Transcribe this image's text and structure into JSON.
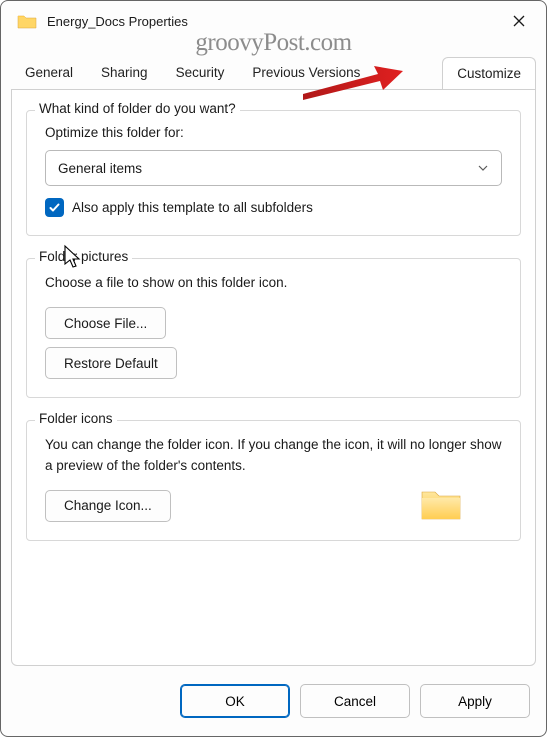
{
  "window": {
    "title": "Energy_Docs Properties"
  },
  "watermark": "groovyPost.com",
  "tabs": [
    {
      "label": "General",
      "active": false
    },
    {
      "label": "Sharing",
      "active": false
    },
    {
      "label": "Security",
      "active": false
    },
    {
      "label": "Previous Versions",
      "active": false
    },
    {
      "label": "Customize",
      "active": true
    }
  ],
  "section_kind": {
    "legend": "What kind of folder do you want?",
    "optimize_label": "Optimize this folder for:",
    "select_value": "General items",
    "checkbox_label": "Also apply this template to all subfolders",
    "checkbox_checked": true
  },
  "section_pictures": {
    "legend": "Folder pictures",
    "desc": "Choose a file to show on this folder icon.",
    "choose_btn": "Choose File...",
    "restore_btn": "Restore Default"
  },
  "section_icons": {
    "legend": "Folder icons",
    "desc": "You can change the folder icon. If you change the icon, it will no longer show a preview of the folder's contents.",
    "change_btn": "Change Icon..."
  },
  "footer": {
    "ok": "OK",
    "cancel": "Cancel",
    "apply": "Apply"
  }
}
